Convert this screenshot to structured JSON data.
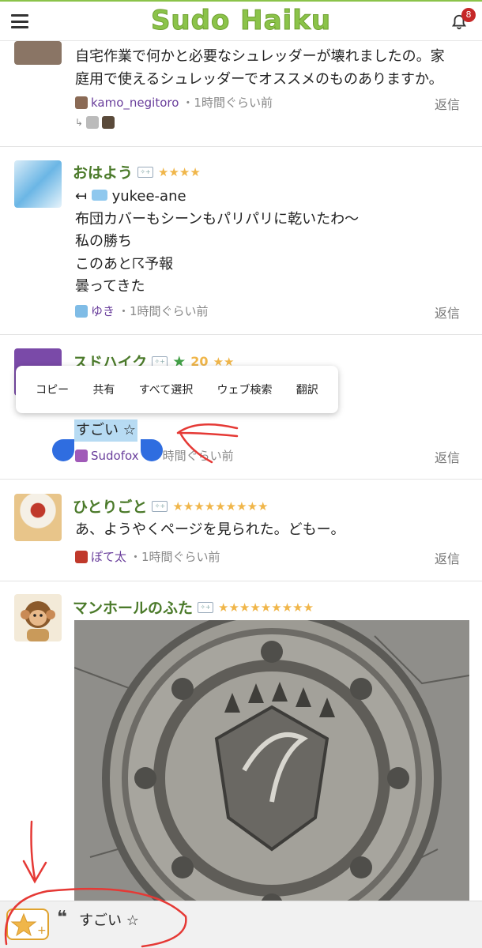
{
  "header": {
    "logo": "Sudo Haiku",
    "notification_count": "8"
  },
  "posts": [
    {
      "body_lines": [
        "自宅作業で何かと必要なシュレッダーが壊れましたの。家",
        "庭用で使えるシュレッダーでオススメのものありますか。"
      ],
      "author": "kamo_negitoro",
      "time": "・1時間ぐらい前",
      "reply": "返信"
    },
    {
      "title": "おはよう",
      "stars": "★★★★",
      "reply_to": "yukee-ane",
      "body_lines": [
        "布団カバーもシーンもパリパリに乾いたわ〜",
        "私の勝ち",
        "このあと☈予報",
        "曇ってきた"
      ],
      "author": "ゆき",
      "time": "・1時間ぐらい前",
      "reply": "返信"
    },
    {
      "title": "スドハイク",
      "green_star": "★",
      "star_count": "20",
      "stars": "★★",
      "selected_text": "すごい ☆",
      "author": "Sudofox",
      "time": "時間ぐらい前",
      "reply": "返信"
    },
    {
      "title": "ひとりごと",
      "stars": "★★★★★★★★★",
      "body_lines": [
        "あ、ようやくページを見られた。どもー。"
      ],
      "author": "ぽて太",
      "time": "・1時間ぐらい前",
      "reply": "返信"
    },
    {
      "title": "マンホールのふた",
      "stars": "★★★★★★★★★"
    }
  ],
  "context_menu": [
    "コピー",
    "共有",
    "すべて選択",
    "ウェブ検索",
    "翻訳"
  ],
  "bottom_bar": {
    "quote_mark": "❝",
    "text": "すごい ☆"
  },
  "icons": {
    "menu": "hamburger-icon",
    "notifications": "bell-icon",
    "add_star": "star-plus-icon"
  },
  "colors": {
    "brand": "#8bc34a",
    "title": "#4b7a2a",
    "star": "#f0b64a",
    "author": "#6a3f9c",
    "badge": "#c62828"
  }
}
